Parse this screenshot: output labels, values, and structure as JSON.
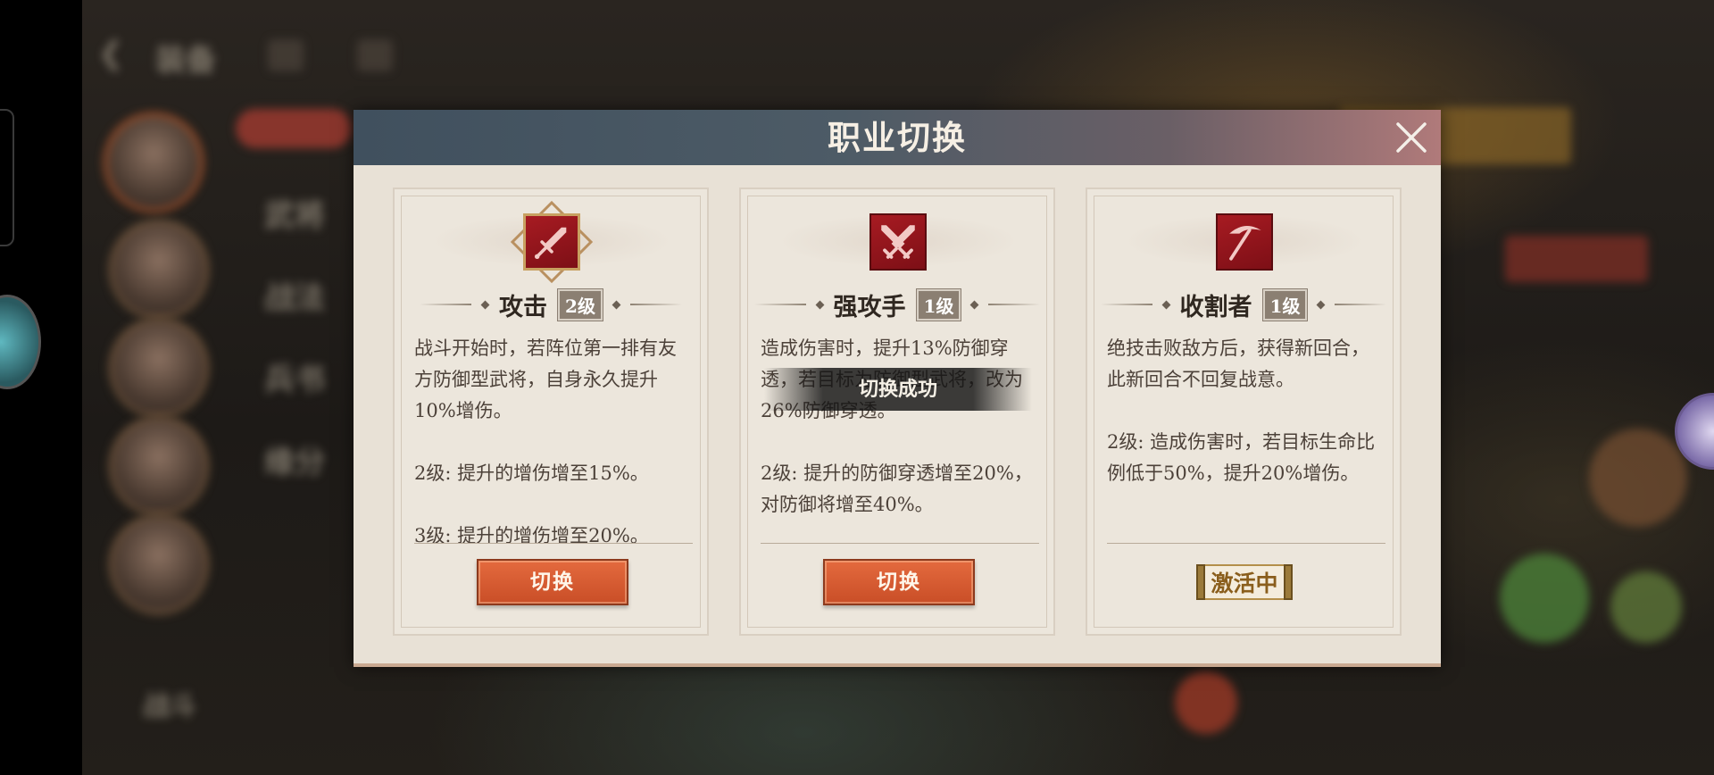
{
  "background": {
    "top_bar_label": "装备",
    "menu_items": [
      "武将",
      "战法",
      "兵书",
      "缘分"
    ],
    "bottom_left_label": "战斗"
  },
  "modal": {
    "title": "职业切换",
    "close_icon": "close-icon"
  },
  "cards": [
    {
      "icon": "sword-icon",
      "name": "攻击",
      "level": "2级",
      "paragraphs": [
        "战斗开始时，若阵位第一排有友方防御型武将，自身永久提升10%增伤。",
        "2级: 提升的增伤增至15%。",
        "3级: 提升的增伤增至20%。"
      ],
      "action": "切换"
    },
    {
      "icon": "crossed-swords-icon",
      "name": "强攻手",
      "level": "1级",
      "paragraphs": [
        "造成伤害时，提升13%防御穿透，若目标为防御型武将，改为26%防御穿透。",
        "2级: 提升的防御穿透增至20%，对防御将增至40%。"
      ],
      "action": "切换"
    },
    {
      "icon": "pickaxe-icon",
      "name": "收割者",
      "level": "1级",
      "paragraphs": [
        "绝技击败敌方后，获得新回合，此新回合不回复战意。",
        "2级: 造成伤害时，若目标生命比例低于50%，提升20%增伤。"
      ],
      "status": "激活中"
    }
  ],
  "toast": "切换成功",
  "colors": {
    "header_start": "#40505e",
    "header_end": "#b07a7a",
    "icon_red": "#a71b22",
    "button_orange": "#e46a3e",
    "active_gold": "#9b7a3a"
  }
}
